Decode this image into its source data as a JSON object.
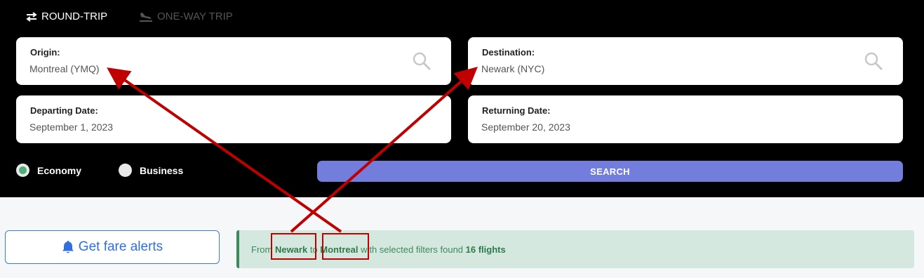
{
  "trip_tabs": {
    "round_trip": "ROUND-TRIP",
    "one_way": "ONE-WAY TRIP"
  },
  "origin": {
    "label": "Origin:",
    "value": "Montreal (YMQ)"
  },
  "destination": {
    "label": "Destination:",
    "value": "Newark (NYC)"
  },
  "departing": {
    "label": "Departing Date:",
    "value": "September 1, 2023"
  },
  "returning": {
    "label": "Returning Date:",
    "value": "September 20, 2023"
  },
  "cabin": {
    "economy": "Economy",
    "business": "Business",
    "selected": "Economy"
  },
  "search_label": "SEARCH",
  "fare_alerts_label": "Get fare alerts",
  "result": {
    "prefix": "From ",
    "from_city": "Newark",
    "mid": " to ",
    "to_city": "Montreal",
    "suffix": " with selected filters found ",
    "count": "16 flights"
  },
  "colors": {
    "accent": "#737ddb",
    "success": "#3a8a5c",
    "annotation": "#c00000"
  }
}
